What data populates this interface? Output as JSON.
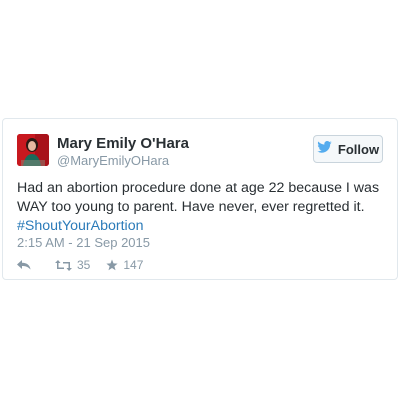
{
  "tweet": {
    "author": {
      "display_name": "Mary Emily O'Hara",
      "handle": "@MaryEmilyOHara"
    },
    "follow_label": "Follow",
    "text_main": "Had an abortion procedure done at age 22 because I was WAY too young to parent. Have never, ever regretted it.",
    "hashtag": "#ShoutYourAbortion",
    "timestamp": "2:15 AM - 21 Sep 2015",
    "retweet_count": "35",
    "like_count": "147"
  },
  "icons": {
    "follow": "bird-icon",
    "reply": "reply-icon",
    "retweet": "retweet-icon",
    "like": "star-icon"
  },
  "colors": {
    "brand_blue": "#55acee",
    "hashtag": "#2b7bb9",
    "text": "#292f33",
    "muted": "#8899a6",
    "border": "#e1e8ed"
  }
}
